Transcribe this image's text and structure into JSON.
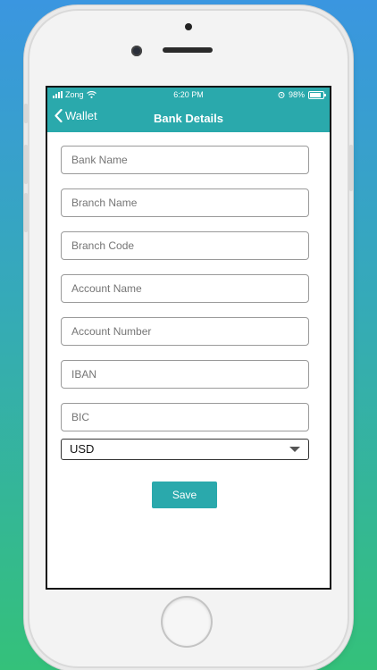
{
  "status_bar": {
    "carrier": "Zong",
    "time": "6:20 PM",
    "battery": "98%"
  },
  "nav": {
    "back_label": "Wallet",
    "title": "Bank Details"
  },
  "form": {
    "fields": [
      {
        "placeholder": "Bank Name"
      },
      {
        "placeholder": "Branch Name"
      },
      {
        "placeholder": "Branch Code"
      },
      {
        "placeholder": "Account Name"
      },
      {
        "placeholder": "Account Number"
      },
      {
        "placeholder": "IBAN"
      },
      {
        "placeholder": "BIC"
      }
    ],
    "currency": "USD",
    "save_label": "Save"
  },
  "colors": {
    "accent": "#2aa9ac",
    "bg_top": "#3a96e0",
    "bg_bottom": "#34c17a"
  },
  "icons": [
    "signal-icon",
    "wifi-icon",
    "alarm-icon",
    "battery-icon",
    "chevron-left-icon",
    "dropdown-caret-icon"
  ]
}
